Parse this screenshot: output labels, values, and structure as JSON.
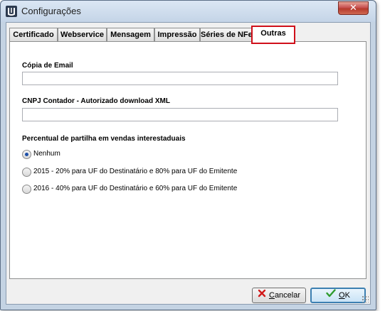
{
  "window": {
    "title": "Configurações",
    "close_glyph": "✕"
  },
  "tabs": [
    {
      "label": "Certificado",
      "active": false
    },
    {
      "label": "Webservice",
      "active": false
    },
    {
      "label": "Mensagem",
      "active": false
    },
    {
      "label": "Impressão",
      "active": false
    },
    {
      "label": "Séries de NFe",
      "active": false
    },
    {
      "label": "Outras",
      "active": true
    }
  ],
  "form": {
    "copia_email": {
      "label": "Cópia de  Email",
      "value": ""
    },
    "cnpj_contador": {
      "label": "CNPJ Contador - Autorizado download XML",
      "value": ""
    },
    "partilha": {
      "label": "Percentual de partilha em vendas interestaduais",
      "options": [
        {
          "label": "Nenhum",
          "checked": true
        },
        {
          "label": "2015 - 20% para UF do Destinatário e 80% para UF do Emitente",
          "checked": false
        },
        {
          "label": "2016 - 40% para UF do Destinatário e 60% para UF do Emitente",
          "checked": false
        }
      ]
    }
  },
  "buttons": {
    "cancel": {
      "mnemonic": "C",
      "rest": "ancelar",
      "icon": "red-x-icon"
    },
    "ok": {
      "mnemonic": "O",
      "rest": "K",
      "icon": "green-check-icon"
    }
  },
  "colors": {
    "active_tab_highlight": "#d0101a",
    "close_button": "#c75050",
    "cancel_icon": "#d11a1a",
    "ok_icon": "#2e9b2e"
  }
}
